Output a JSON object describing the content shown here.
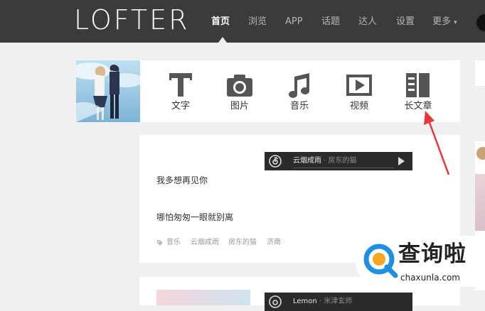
{
  "header": {
    "logo_text": "LOFTER",
    "nav": [
      "首页",
      "浏览",
      "APP",
      "话题",
      "达人",
      "设置",
      "更多"
    ],
    "active_index": 0,
    "more_caret": "▾"
  },
  "publish": {
    "items": [
      {
        "label": "文字",
        "icon": "text-icon"
      },
      {
        "label": "图片",
        "icon": "camera-icon"
      },
      {
        "label": "音乐",
        "icon": "music-note-icon"
      },
      {
        "label": "视频",
        "icon": "video-icon"
      },
      {
        "label": "长文章",
        "icon": "long-article-icon"
      }
    ]
  },
  "post": {
    "music": {
      "title": "云烟成雨",
      "separator": " · ",
      "artist": "房东的猫"
    },
    "lines": [
      "我多想再见你",
      "哪怕匆匆一眼就别离"
    ],
    "tags": [
      "音乐",
      "云烟成雨",
      "房东的猫",
      "济南"
    ]
  },
  "post2": {
    "music": {
      "title": "Lemon",
      "separator": " · ",
      "artist": "米津玄师"
    }
  },
  "watermark": {
    "text": "查询啦",
    "url": "chaxunla.com"
  },
  "colors": {
    "topbar": "#3b3b3b",
    "background": "#f0f0f0",
    "arrow": "#e8373a",
    "player": "#2b2b2b",
    "watermark_blue": "#1e8fe1",
    "watermark_orange": "#f5a623"
  }
}
